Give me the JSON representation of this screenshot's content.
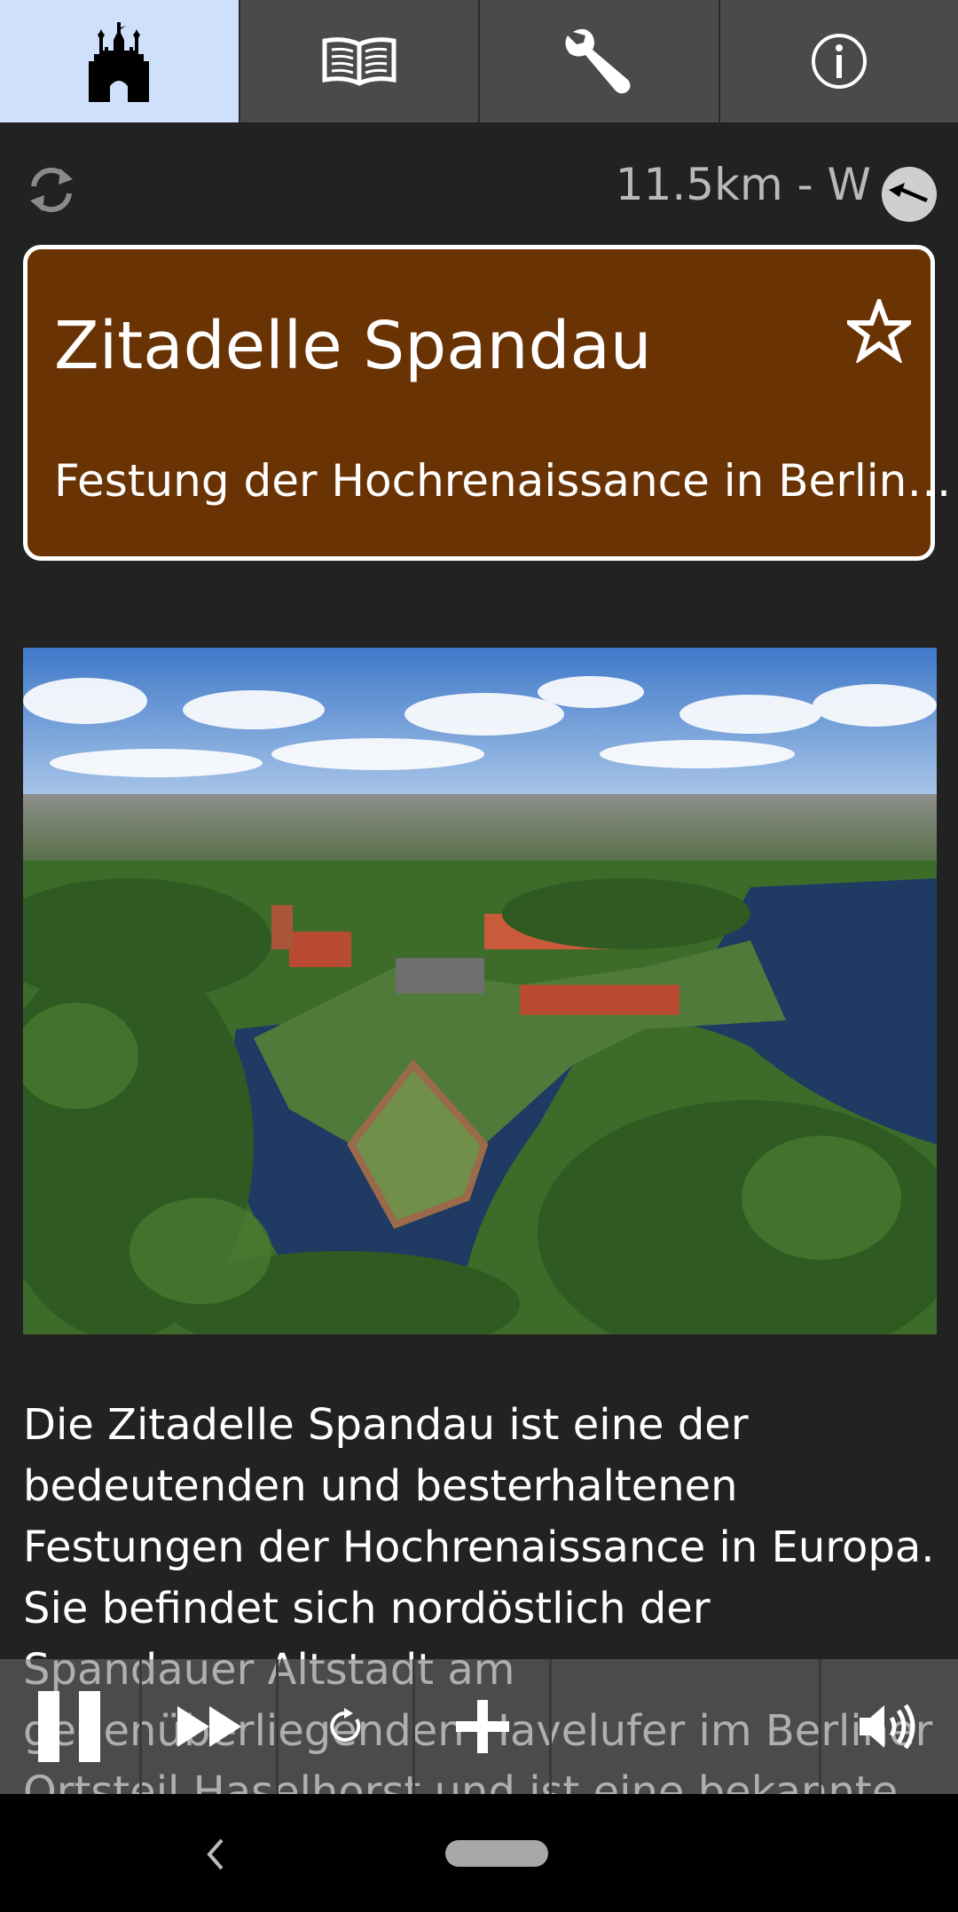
{
  "tabs": [
    {
      "icon": "castle-icon",
      "active": true
    },
    {
      "icon": "book-icon",
      "active": false
    },
    {
      "icon": "wrench-icon",
      "active": false
    },
    {
      "icon": "info-icon",
      "active": false
    }
  ],
  "status": {
    "refresh_icon": "refresh-icon",
    "distance": "11.5km - W",
    "compass_icon": "compass-arrow-icon"
  },
  "poi": {
    "title": "Zitadelle Spandau",
    "subtitle": "Festung der Hochrenaissance in Berlin…",
    "favorite_icon": "star-icon",
    "description": "Die Zitadelle Spandau ist eine der bedeutenden und besterhaltenen Festungen der Hochrenaissance in Europa. Sie befindet sich nordöstlich der Spandauer Altstadt am gegenüberliegenden Havelufer im Berliner Ortsteil Haselhorst und ist eine bekannte"
  },
  "player": {
    "buttons": [
      "pause-icon",
      "fast-forward-icon",
      "replay-icon",
      "plus-icon",
      "volume-icon"
    ]
  },
  "colors": {
    "active_tab": "#cfe0fb",
    "card_background": "#6a3304",
    "app_background": "#222222"
  }
}
